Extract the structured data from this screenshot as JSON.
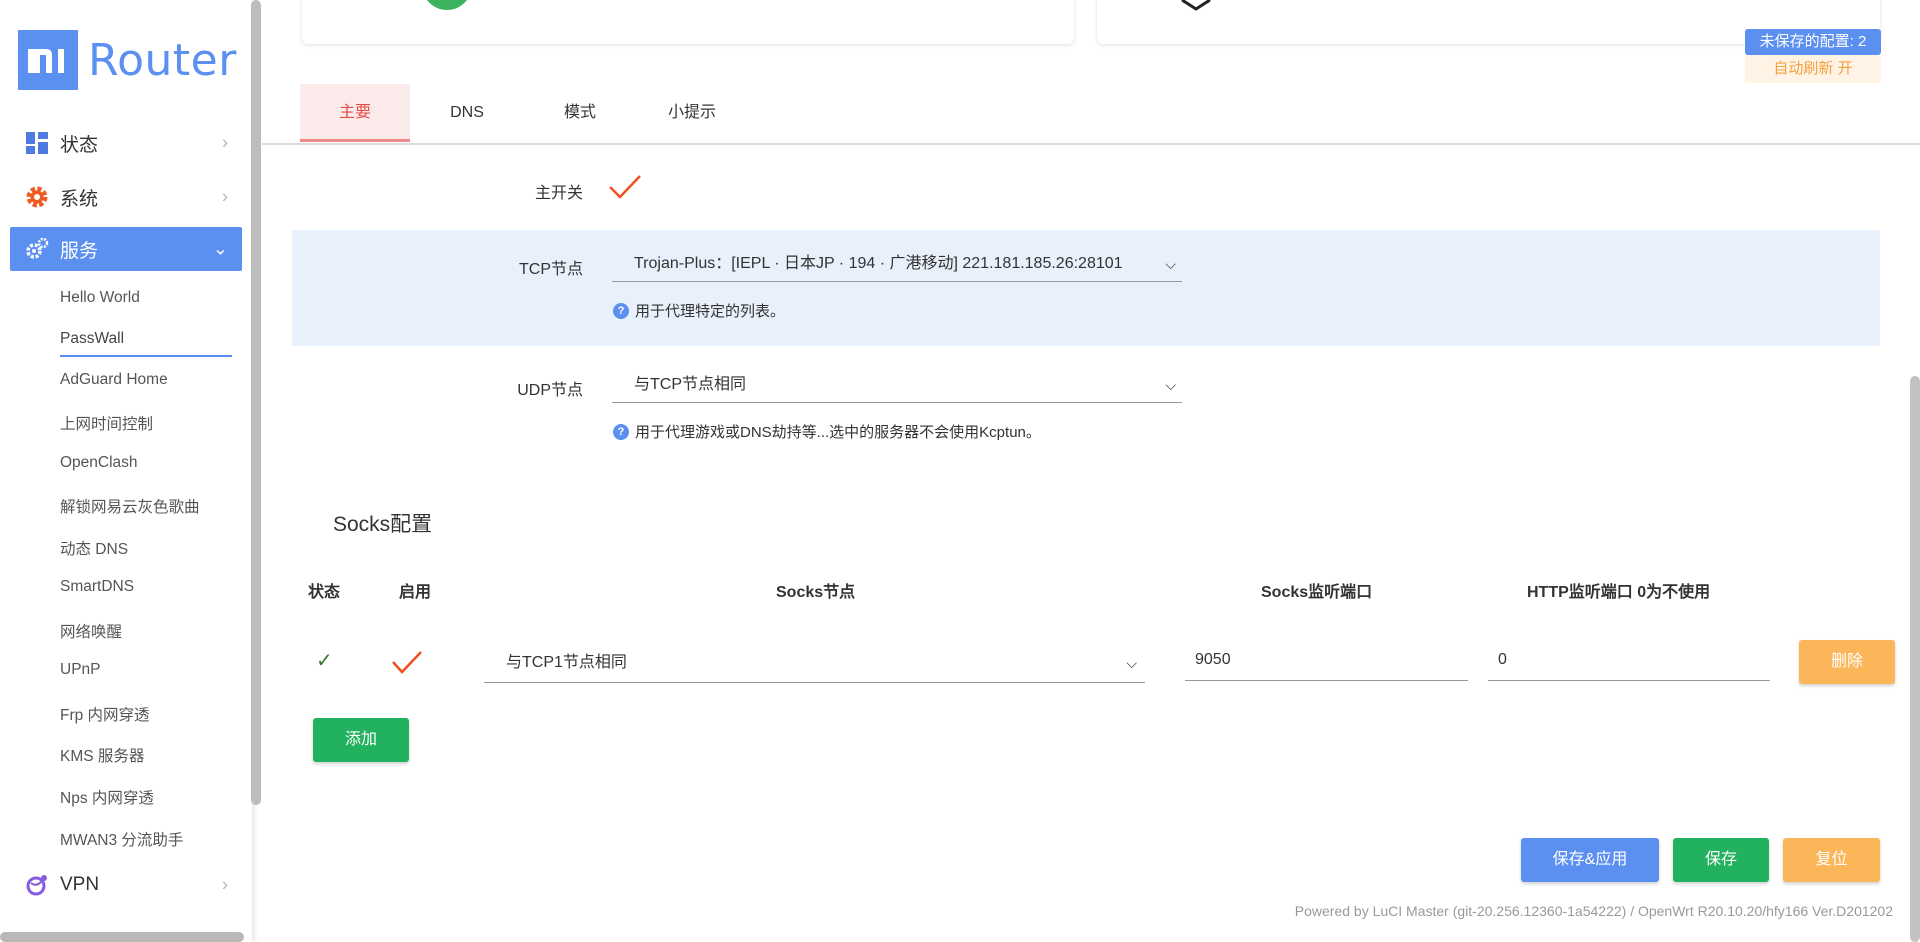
{
  "brand": {
    "logo_text": "Router",
    "accent": "#5b8ff0"
  },
  "sidebar": {
    "main_items": [
      {
        "label": "状态",
        "icon": "dashboard-icon"
      },
      {
        "label": "系统",
        "icon": "gear-icon"
      },
      {
        "label": "服务",
        "icon": "gears-icon"
      },
      {
        "label": "VPN",
        "icon": "globe-icon"
      }
    ],
    "sub_items": [
      "Hello World",
      "PassWall",
      "AdGuard Home",
      "上网时间控制",
      "OpenClash",
      "解锁网易云灰色歌曲",
      "动态 DNS",
      "SmartDNS",
      "网络唤醒",
      "UPnP",
      "Frp 内网穿透",
      "KMS 服务器",
      "Nps 内网穿透",
      "MWAN3 分流助手"
    ],
    "current_sub": "PassWall"
  },
  "header": {
    "unsaved_label": "未保存的配置: 2",
    "auto_refresh_label": "自动刷新 开"
  },
  "tabs": [
    "主要",
    "DNS",
    "模式",
    "小提示"
  ],
  "form": {
    "main_switch_label": "主开关",
    "tcp_label": "TCP节点",
    "tcp_value": "Trojan-Plus：[IEPL · 日本JP · 194 · 广港移动] 221.181.185.26:28101",
    "tcp_hint": "用于代理特定的列表。",
    "udp_label": "UDP节点",
    "udp_value": "与TCP节点相同",
    "udp_hint": "用于代理游戏或DNS劫持等...选中的服务器不会使用Kcptun。"
  },
  "socks": {
    "title": "Socks配置",
    "headers": [
      "状态",
      "启用",
      "Socks节点",
      "Socks监听端口",
      "HTTP监听端口 0为不使用"
    ],
    "row": {
      "status_mark": "✓",
      "node": "与TCP1节点相同",
      "socks_port": "9050",
      "http_port": "0",
      "delete_label": "删除"
    },
    "add_label": "添加"
  },
  "actions": {
    "save_apply": "保存&应用",
    "save": "保存",
    "reset": "复位"
  },
  "footer": "Powered by LuCI Master (git-20.256.12360-1a54222) / OpenWrt R20.10.20/hfy166 Ver.D201202"
}
